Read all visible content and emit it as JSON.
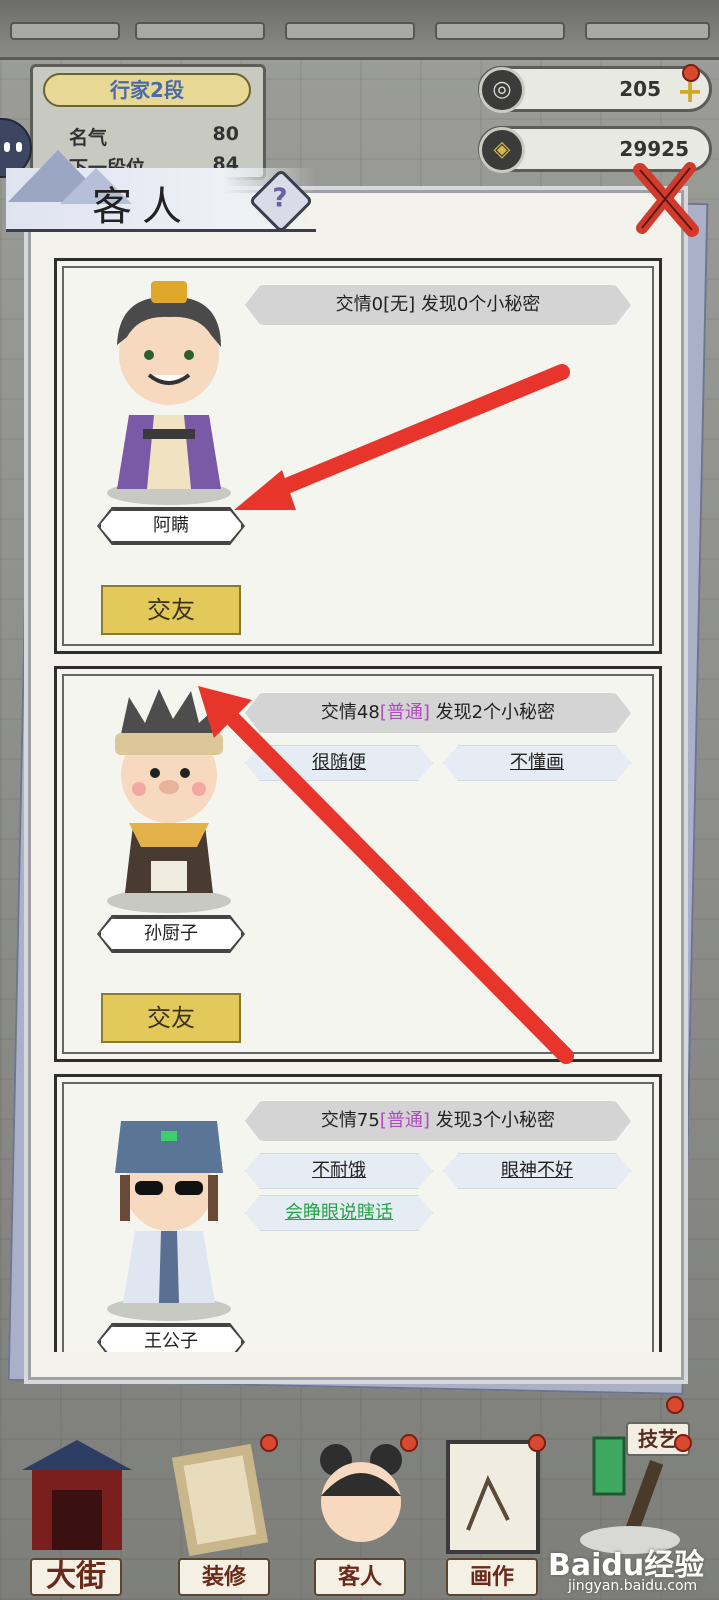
{
  "rank": {
    "title": "行家2段",
    "fame_label": "名气",
    "fame_value": "80",
    "next_label": "下一段位",
    "next_value": "84"
  },
  "currency": {
    "gem_value": "205",
    "coin_value": "29925"
  },
  "modal": {
    "title": "客人",
    "help_symbol": "?"
  },
  "guests": [
    {
      "name": "阿瞒",
      "relation_prefix": "交情0",
      "relation_level": "[无]",
      "relation_suffix": " 发现0个小秘密",
      "secrets": [],
      "button": "交友"
    },
    {
      "name": "孙厨子",
      "relation_prefix": "交情48",
      "relation_level": "[普通]",
      "relation_suffix": " 发现2个小秘密",
      "secrets": [
        "很随便",
        "不懂画"
      ],
      "button": "交友"
    },
    {
      "name": "王公子",
      "relation_prefix": "交情75",
      "relation_level": "[普通]",
      "relation_suffix": " 发现3个小秘密",
      "secrets": [
        "不耐饿",
        "眼神不好",
        "会睁眼说瞎话"
      ]
    }
  ],
  "nav": {
    "skill": "技艺",
    "street": "大街",
    "decorate": "装修",
    "guests": "客人",
    "paint": "画作"
  },
  "watermark": {
    "brand": "Baidu经验",
    "url": "jingyan.baidu.com"
  },
  "colors": {
    "level_purple": "#b24ac4",
    "friend_button": "#e2c95a",
    "arrow_red": "#e8352b",
    "secret_green": "#2aa34a"
  }
}
